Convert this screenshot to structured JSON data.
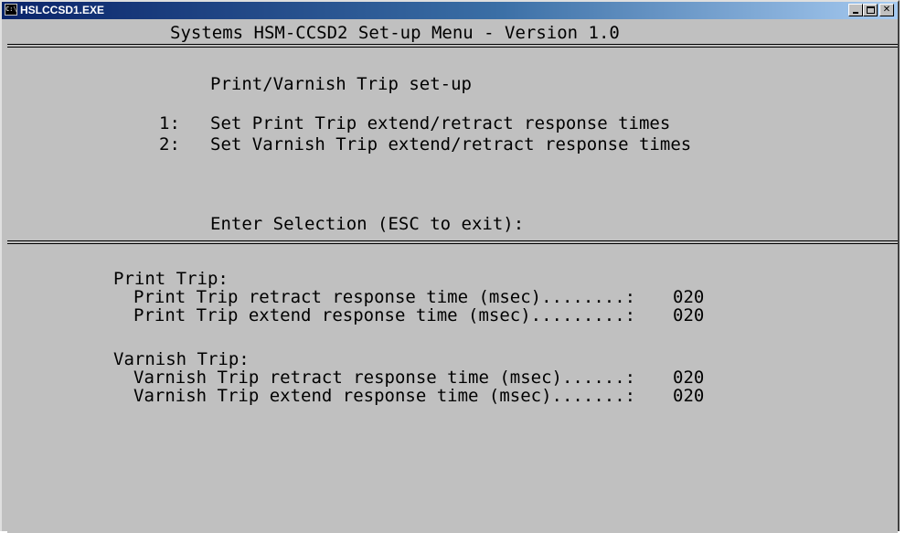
{
  "window": {
    "title": "HSLCCSD1.EXE",
    "icon": "console-icon",
    "controls": {
      "minimize": "minimize-icon",
      "maximize": "maximize-icon",
      "close": "close-icon",
      "close_glyph": "✕"
    }
  },
  "console": {
    "header": "Systems HSM-CCSD2 Set-up Menu - Version 1.0",
    "menu": {
      "title": "Print/Varnish Trip set-up",
      "options": [
        {
          "key": "1:",
          "label": "Set Print Trip extend/retract response times"
        },
        {
          "key": "2:",
          "label": "Set Varnish Trip extend/retract response times"
        }
      ],
      "prompt": "Enter Selection (ESC to exit):"
    },
    "settings": [
      {
        "heading": "Print Trip:",
        "rows": [
          {
            "label": "Print Trip retract response time (msec)........:",
            "value": "020"
          },
          {
            "label": "Print Trip extend response time (msec).........:",
            "value": "020"
          }
        ]
      },
      {
        "heading": "Varnish Trip:",
        "rows": [
          {
            "label": "Varnish Trip retract response time (msec)......:",
            "value": "020"
          },
          {
            "label": "Varnish Trip extend response time (msec).......:",
            "value": "020"
          }
        ]
      }
    ]
  },
  "colors": {
    "titlebar_start": "#0a246a",
    "titlebar_end": "#a6caf0",
    "console_background": "#c0c0c0",
    "console_text": "#000000"
  }
}
